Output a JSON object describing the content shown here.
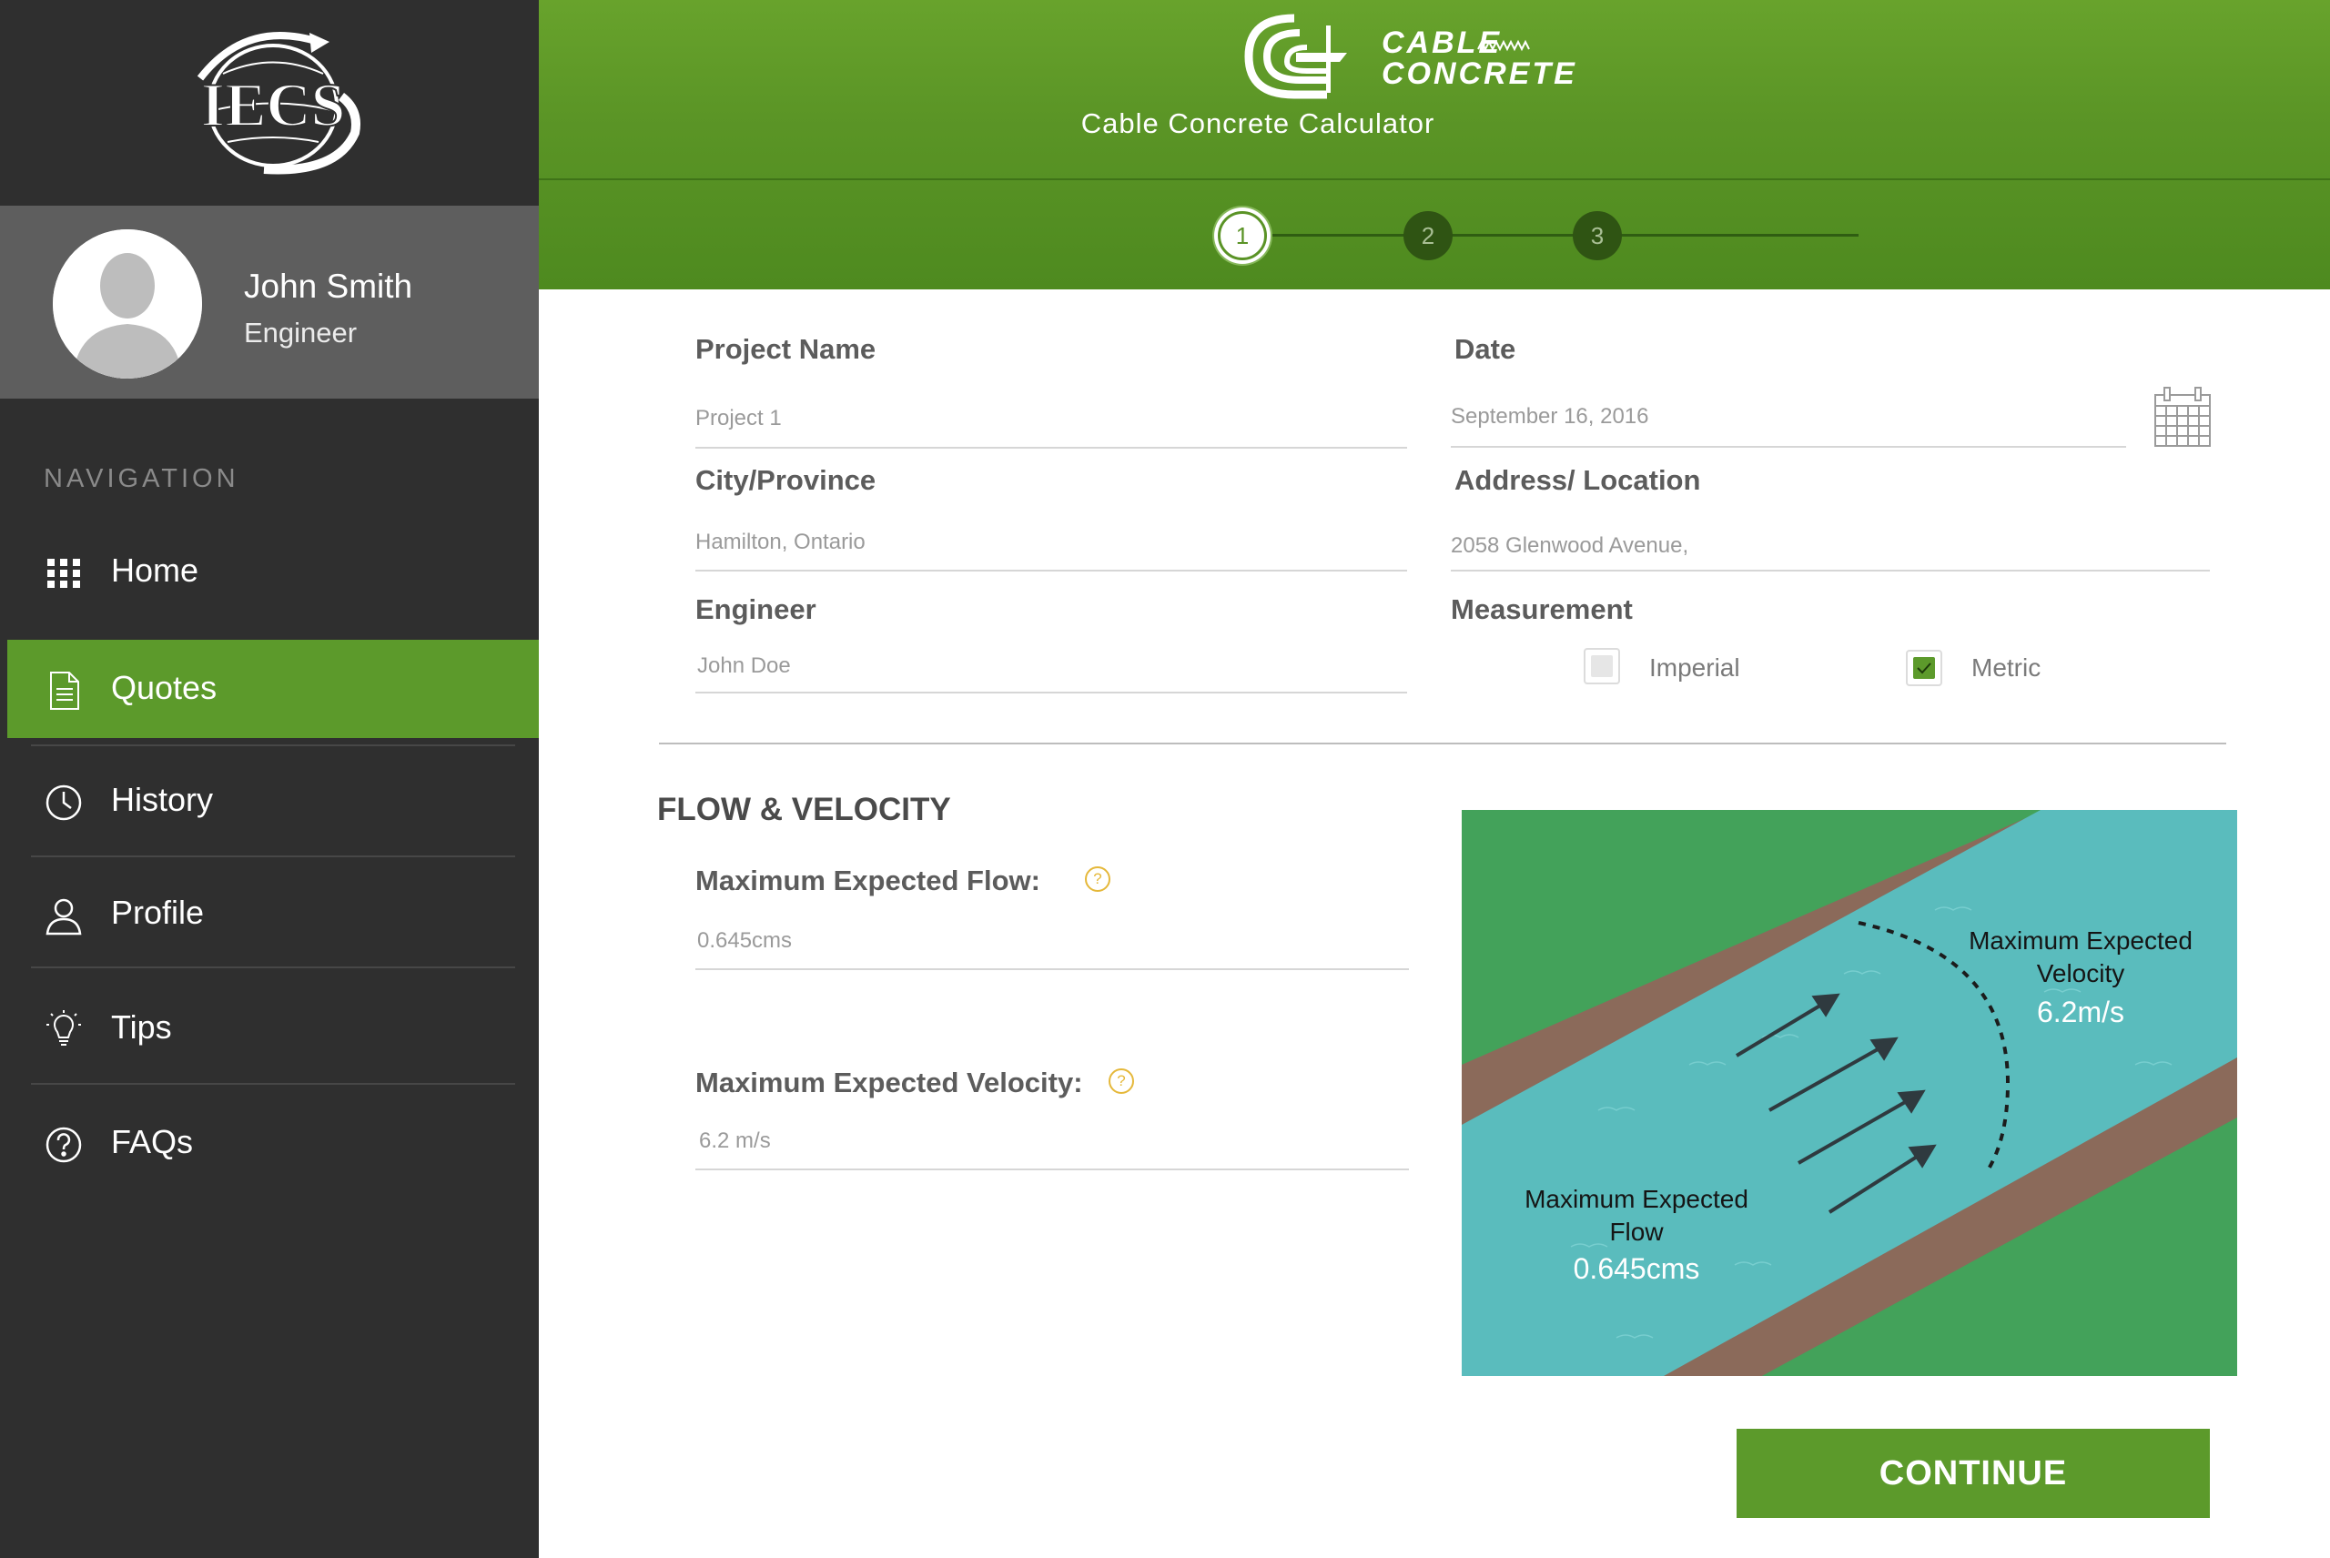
{
  "sidebar": {
    "logo_text": "IECS",
    "user": {
      "name": "John Smith",
      "role": "Engineer"
    },
    "nav_heading": "NAVIGATION",
    "items": [
      {
        "label": "Home",
        "icon": "grid-icon",
        "active": false
      },
      {
        "label": "Quotes",
        "icon": "document-icon",
        "active": true
      },
      {
        "label": "History",
        "icon": "clock-icon",
        "active": false
      },
      {
        "label": "Profile",
        "icon": "user-icon",
        "active": false
      },
      {
        "label": "Tips",
        "icon": "lightbulb-icon",
        "active": false
      },
      {
        "label": "FAQs",
        "icon": "question-icon",
        "active": false
      }
    ]
  },
  "header": {
    "brand_line1": "CABLE",
    "brand_line2": "CONCRETE",
    "title": "Cable Concrete Calculator",
    "steps": [
      "1",
      "2",
      "3"
    ],
    "current_step": 1
  },
  "form": {
    "project_name": {
      "label": "Project Name",
      "value": "Project 1"
    },
    "date": {
      "label": "Date",
      "value": "September 16, 2016"
    },
    "city": {
      "label": "City/Province",
      "value": "Hamilton, Ontario"
    },
    "address": {
      "label": "Address/ Location",
      "value": "2058 Glenwood Avenue,"
    },
    "engineer": {
      "label": "Engineer",
      "value": "John Doe"
    },
    "measurement": {
      "label": "Measurement",
      "options": [
        {
          "label": "Imperial",
          "checked": false
        },
        {
          "label": "Metric",
          "checked": true
        }
      ]
    }
  },
  "flow": {
    "title": "FLOW & VELOCITY",
    "max_flow": {
      "label": "Maximum Expected Flow:",
      "value": "0.645cms"
    },
    "max_velocity": {
      "label": "Maximum Expected Velocity:",
      "value": "6.2 m/s"
    },
    "help_glyph": "?"
  },
  "illustration": {
    "velocity_label_line1": "Maximum Expected",
    "velocity_label_line2": "Velocity",
    "velocity_value": "6.2m/s",
    "flow_label_line1": "Maximum Expected",
    "flow_label_line2": "Flow",
    "flow_value": "0.645cms",
    "colors": {
      "grass": "#43a25a",
      "bank": "#8b6a5a",
      "water": "#5abcbd"
    }
  },
  "actions": {
    "continue_label": "CONTINUE"
  },
  "colors": {
    "accent": "#5c9a2b",
    "sidebar": "#2f2f2f",
    "profile": "#5e5e5e",
    "header": "#5b9526"
  }
}
